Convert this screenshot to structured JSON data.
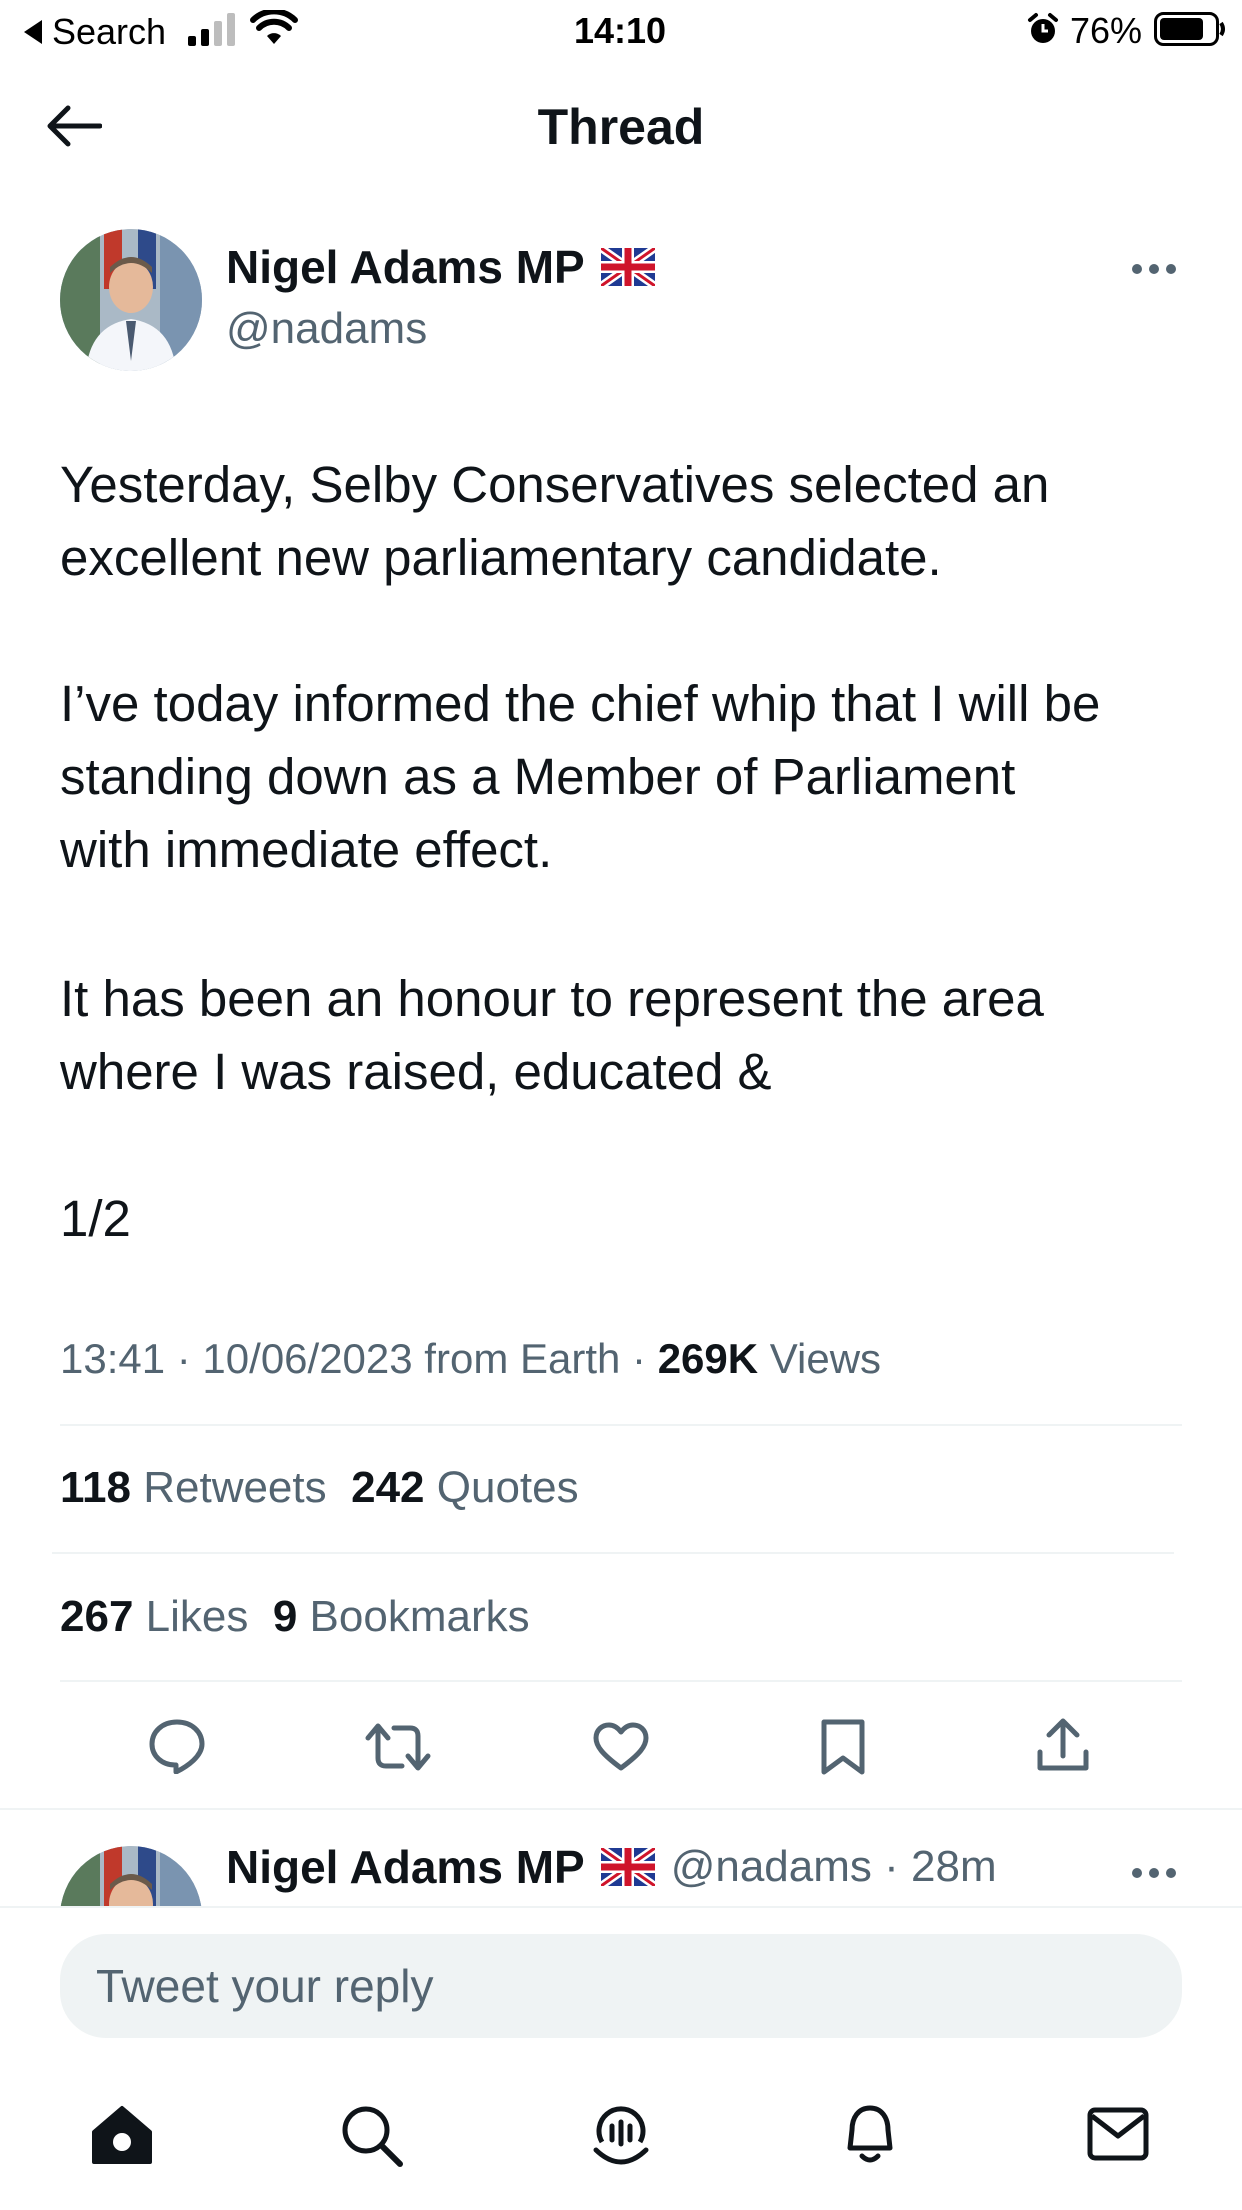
{
  "status_bar": {
    "back_label": "Search",
    "time": "14:10",
    "battery": "76%",
    "battery_level": 0.76
  },
  "header": {
    "title": "Thread"
  },
  "tweet": {
    "author_name": "Nigel Adams MP",
    "flag": "🇬🇧",
    "handle": "@nadams",
    "paragraphs": [
      "Yesterday, Selby Conservatives selected an\nexcellent new parliamentary candidate.",
      "I’ve today informed the chief whip that I will be\nstanding down as a Member of Parliament\nwith immediate effect.",
      "It has been an honour to represent the area\nwhere I was raised, educated &",
      "1/2"
    ],
    "timestamp": "13:41 · 10/06/2023 from Earth · ",
    "views_count": "269K",
    "views_label": "Views",
    "retweets_count": "118",
    "retweets_label": "Retweets",
    "quotes_count": "242",
    "quotes_label": "Quotes",
    "likes_count": "267",
    "likes_label": "Likes",
    "bookmarks_count": "9",
    "bookmarks_label": "Bookmarks"
  },
  "actions": [
    "reply-icon",
    "retweet-icon",
    "like-icon",
    "bookmark-icon",
    "share-icon"
  ],
  "next_tweet": {
    "author_name": "Nigel Adams MP",
    "handle_time": "@nadams · 28m"
  },
  "reply": {
    "placeholder": "Tweet your reply"
  },
  "tab_bar": [
    "home-icon",
    "search-icon",
    "spaces-icon",
    "notifications-icon",
    "messages-icon"
  ],
  "colors": {
    "text": "#0f1419",
    "secondary": "#536471",
    "divider": "#eff3f4"
  }
}
